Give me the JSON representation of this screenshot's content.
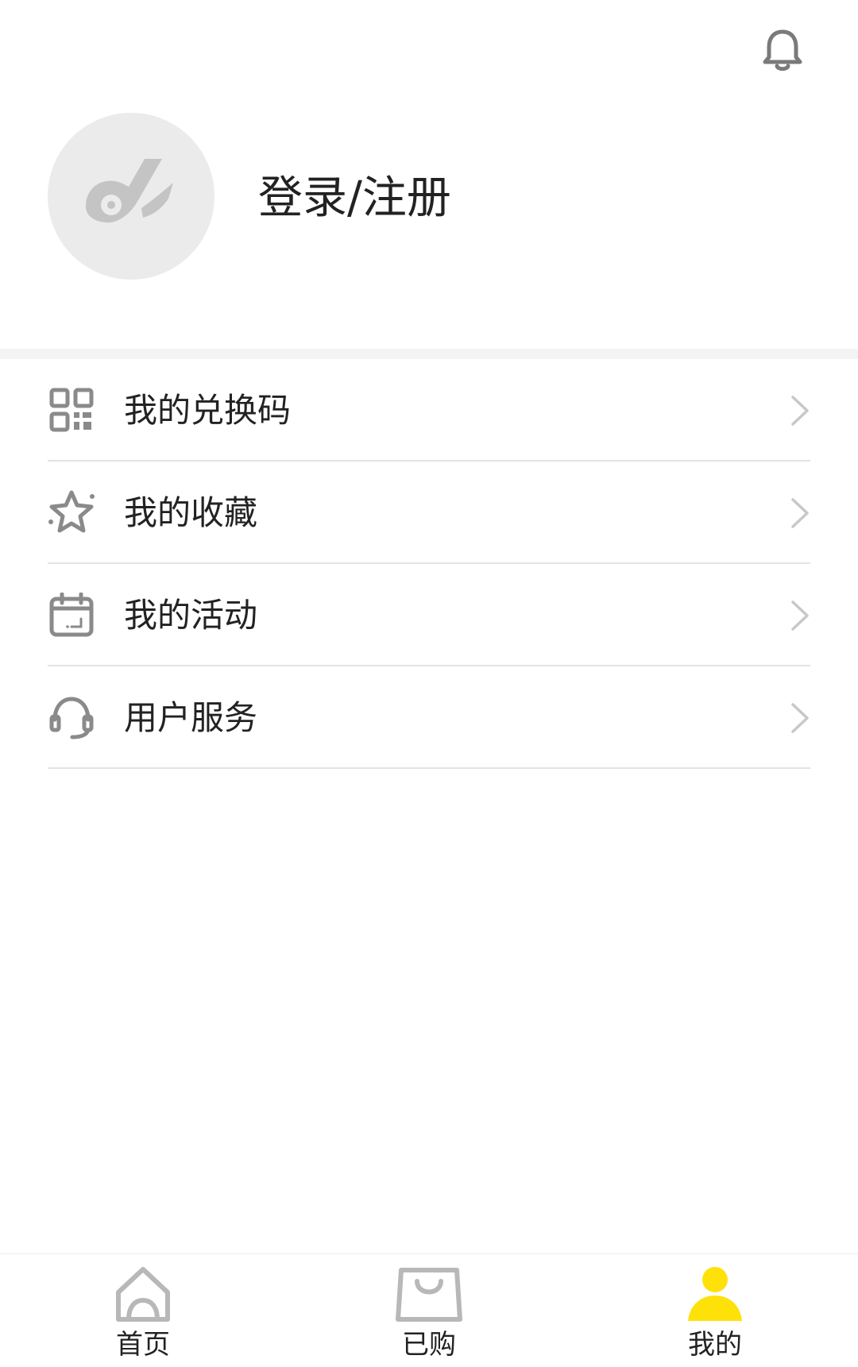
{
  "header": {
    "notification_icon": "bell-icon"
  },
  "profile": {
    "avatar_icon": "app-logo-icon",
    "login_label": "登录/注册"
  },
  "menu": {
    "items": [
      {
        "label": "我的兑换码",
        "icon": "qr-code-icon"
      },
      {
        "label": "我的收藏",
        "icon": "star-icon"
      },
      {
        "label": "我的活动",
        "icon": "calendar-icon"
      },
      {
        "label": "用户服务",
        "icon": "headset-icon"
      }
    ]
  },
  "tabbar": {
    "tabs": [
      {
        "label": "首页",
        "icon": "home-icon",
        "active": false
      },
      {
        "label": "已购",
        "icon": "shopping-bag-icon",
        "active": false
      },
      {
        "label": "我的",
        "icon": "user-icon",
        "active": true
      }
    ]
  },
  "colors": {
    "accent": "#FFE10A",
    "icon_gray": "#8a8a8a",
    "chevron_gray": "#c8c8c8",
    "divider": "#e3e3e3",
    "section_gap": "#f4f4f4"
  }
}
